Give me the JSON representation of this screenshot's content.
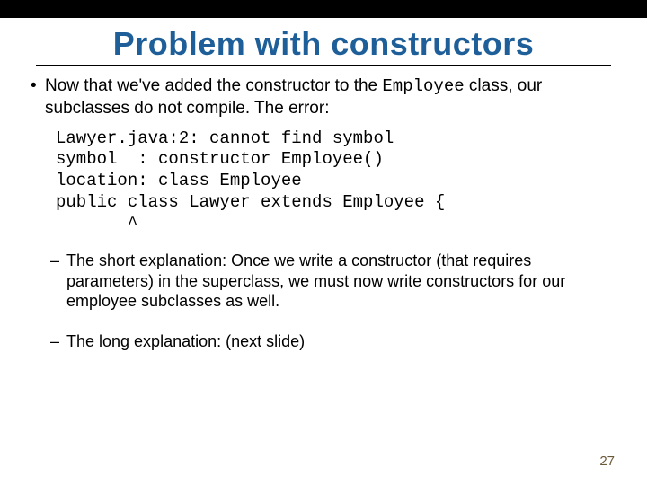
{
  "title": "Problem with constructors",
  "bullet1": {
    "pre": "Now that we've added the constructor to the ",
    "code": "Employee",
    "post": " class, our subclasses do not compile.  The error:"
  },
  "code_lines": "Lawyer.java:2: cannot find symbol\nsymbol  : constructor Employee()\nlocation: class Employee\npublic class Lawyer extends Employee {\n       ^",
  "sub1": "The short explanation: Once we write a constructor (that requires parameters) in the superclass, we must now write constructors for our employee subclasses as well.",
  "sub2": "The long explanation: (next slide)",
  "page": "27"
}
